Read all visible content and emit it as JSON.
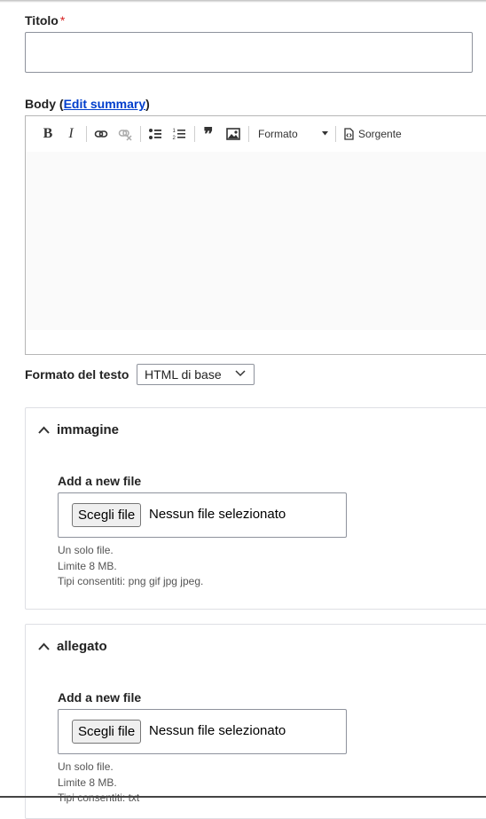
{
  "title_field": {
    "label": "Titolo",
    "required_mark": "*",
    "value": ""
  },
  "body_field": {
    "label": "Body",
    "paren_open": "(",
    "edit_summary_link": "Edit summary",
    "paren_close": ")",
    "toolbar": {
      "bold": "B",
      "italic": "I",
      "blockquote": "❞",
      "format_label": "Formato",
      "source_label": "Sorgente"
    }
  },
  "text_format": {
    "label": "Formato del testo",
    "selected": "HTML di base"
  },
  "image_section": {
    "title": "immagine",
    "add_label": "Add a new file",
    "choose_button": "Scegli file",
    "status": "Nessun file selezionato",
    "help": [
      "Un solo file.",
      "Limite 8 MB.",
      "Tipi consentiti: png gif jpg jpeg."
    ]
  },
  "attachment_section": {
    "title": "allegato",
    "add_label": "Add a new file",
    "choose_button": "Scegli file",
    "status": "Nessun file selezionato",
    "help": [
      "Un solo file.",
      "Limite 8 MB.",
      "Tipi consentiti: txt"
    ]
  }
}
